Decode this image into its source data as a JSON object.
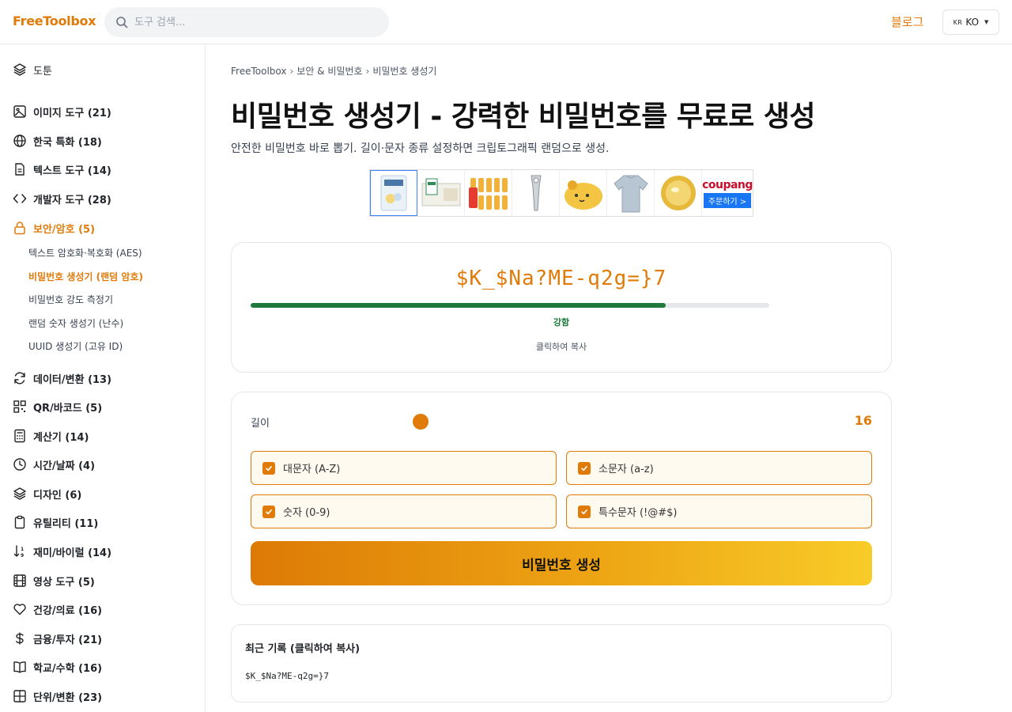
{
  "header": {
    "logo": "FreeToolbox",
    "search_placeholder": "도구 검색...",
    "blog": "블로그",
    "lang_flag": "KR",
    "lang_code": "KO"
  },
  "sidebar": {
    "top": "도툰",
    "categories": [
      {
        "label": "이미지 도구 (21)",
        "icon": "image-icon"
      },
      {
        "label": "한국 특화 (18)",
        "icon": "globe-icon"
      },
      {
        "label": "텍스트 도구 (14)",
        "icon": "file-text-icon"
      },
      {
        "label": "개발자 도구 (28)",
        "icon": "code-icon"
      },
      {
        "label": "보안/암호 (5)",
        "icon": "lock-icon"
      },
      {
        "label": "데이터/변환 (13)",
        "icon": "refresh-icon"
      },
      {
        "label": "QR/바코드 (5)",
        "icon": "qr-icon"
      },
      {
        "label": "계산기 (14)",
        "icon": "calculator-icon"
      },
      {
        "label": "시간/날짜 (4)",
        "icon": "clock-icon"
      },
      {
        "label": "디자인 (6)",
        "icon": "layers-icon"
      },
      {
        "label": "유틸리티 (11)",
        "icon": "clipboard-icon"
      },
      {
        "label": "재미/바이럴 (14)",
        "icon": "sort-icon"
      },
      {
        "label": "영상 도구 (5)",
        "icon": "film-icon"
      },
      {
        "label": "건강/의료 (16)",
        "icon": "heart-icon"
      },
      {
        "label": "금융/투자 (21)",
        "icon": "dollar-icon"
      },
      {
        "label": "학교/수학 (16)",
        "icon": "book-icon"
      },
      {
        "label": "단위/변환 (23)",
        "icon": "grid-icon"
      }
    ],
    "security_sub": [
      "텍스트 암호화·복호화 (AES)",
      "비밀번호 생성기 (랜덤 암호)",
      "비밀번호 강도 측정기",
      "랜덤 숫자 생성기 (난수)",
      "UUID 생성기 (고유 ID)"
    ]
  },
  "breadcrumb": [
    "FreeToolbox",
    "보안 & 비밀번호",
    "비밀번호 생성기"
  ],
  "page": {
    "title": "비밀번호 생성기 - 강력한 비밀번호를 무료로 생성",
    "subtitle": "안전한 비밀번호 바로 뽑기. 길이·문자 종류 설정하면 크립토그래픽 랜덤으로 생성."
  },
  "ad": {
    "brand": "coupang",
    "order": "주문하기 >"
  },
  "result": {
    "password": "$K_$Na?ME-q2g=}7",
    "strength": "강함",
    "strength_level": 0.8,
    "copy_hint": "클릭하여 복사"
  },
  "options": {
    "length_label": "길이",
    "length_value": "16",
    "checkboxes": [
      {
        "label": "대문자 (A-Z)",
        "checked": true
      },
      {
        "label": "소문자 (a-z)",
        "checked": true
      },
      {
        "label": "숫자 (0-9)",
        "checked": true
      },
      {
        "label": "특수문자 (!@#$)",
        "checked": true
      }
    ],
    "generate": "비밀번호 생성"
  },
  "history": {
    "title": "최근 기록 (클릭하여 복사)",
    "items": [
      "$K_$Na?ME-q2g=}7"
    ]
  },
  "colors": {
    "accent": "#e07b0a",
    "strong": "#1e7a3c"
  }
}
